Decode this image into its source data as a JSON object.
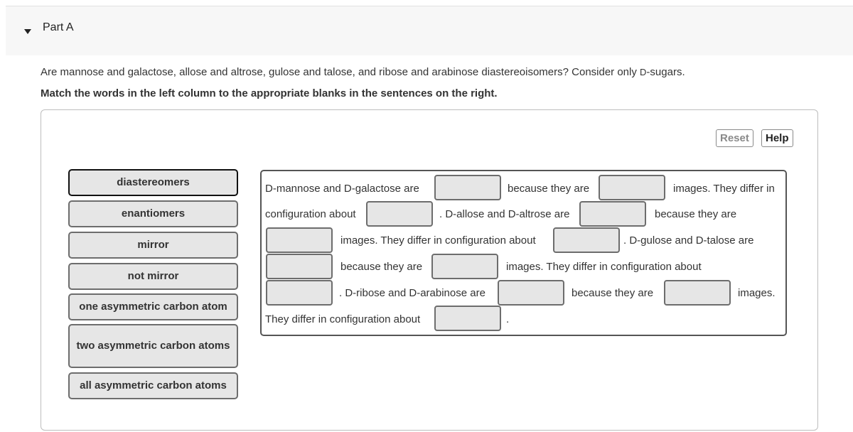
{
  "part": {
    "title": "Part A",
    "toggle_icon": "triangle-down"
  },
  "question": {
    "text_before": "Are mannose and galactose, allose and altrose, gulose and talose, and ribose and arabinose diastereoisomers? Consider only ",
    "smallcap": "D",
    "text_after": "-sugars."
  },
  "instruction": "Match the words in the left column to the appropriate blanks in the sentences on the right.",
  "toolbar": {
    "reset_label": "Reset",
    "help_label": "Help"
  },
  "word_bank": [
    {
      "label": "diastereomers",
      "selected": true
    },
    {
      "label": "enantiomers"
    },
    {
      "label": "mirror"
    },
    {
      "label": "not mirror"
    },
    {
      "label": "one asymmetric carbon atom"
    },
    {
      "label": "two asymmetric carbon atoms"
    },
    {
      "label": "all asymmetric carbon atoms"
    }
  ],
  "sentences": {
    "s1": "D-mannose and D-galactose are",
    "s2": "because they are",
    "s3": "images. They differ in",
    "s4": "configuration about",
    "s5": ". D-allose and D-altrose are",
    "s6": "because they are",
    "s7": "images. They differ in configuration about",
    "s8": ". D-gulose and D-talose are",
    "s9": "because they are",
    "s10": "images. They differ in configuration about",
    "s11": ". D-ribose and D-arabinose are",
    "s12": "because they are",
    "s13": "images.",
    "s14": "They differ in configuration about",
    "s15": "."
  },
  "blanks": [
    "",
    "",
    "",
    "",
    "",
    "",
    "",
    "",
    "",
    "",
    "",
    ""
  ]
}
